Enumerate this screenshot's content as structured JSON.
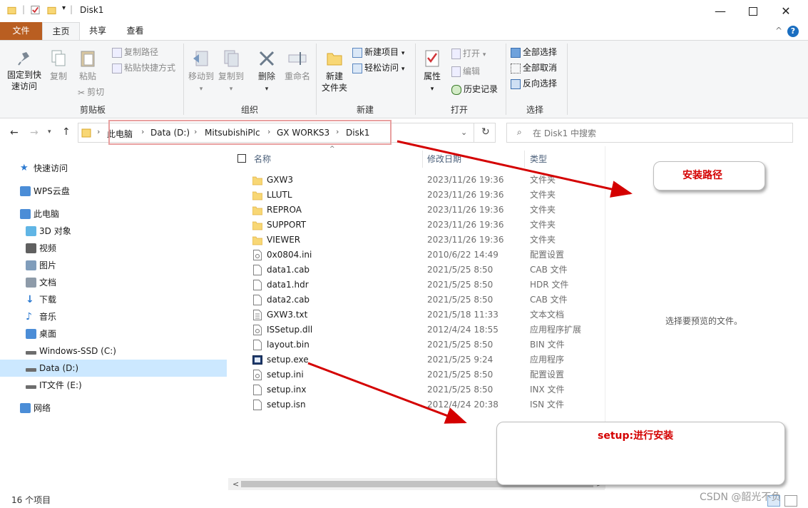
{
  "window": {
    "title": "Disk1"
  },
  "tabs": {
    "file": "文件",
    "home": "主页",
    "share": "共享",
    "view": "查看"
  },
  "ribbon": {
    "clipboard": {
      "pin": [
        "固定到快",
        "速访问"
      ],
      "copy": "复制",
      "paste": "粘贴",
      "copy_path": "复制路径",
      "paste_shortcut": "粘贴快捷方式",
      "cut": "剪切",
      "label": "剪贴板"
    },
    "organize": {
      "move_to": "移动到",
      "copy_to": "复制到",
      "delete": "删除",
      "rename": "重命名",
      "label": "组织"
    },
    "new": {
      "new_item": "新建项目",
      "easy_access": "轻松访问",
      "new_folder": [
        "新建",
        "文件夹"
      ],
      "label": "新建"
    },
    "open": {
      "properties": "属性",
      "open": "打开",
      "edit": "编辑",
      "history": "历史记录",
      "label": "打开"
    },
    "select": {
      "select_all": "全部选择",
      "select_none": "全部取消",
      "invert": "反向选择",
      "label": "选择"
    }
  },
  "address": {
    "crumbs": [
      "此电脑",
      "Data (D:)",
      "MitsubishiPlc",
      "GX WORKS3",
      "Disk1"
    ]
  },
  "search": {
    "placeholder": "在 Disk1 中搜索"
  },
  "nav": [
    {
      "label": "快速访问",
      "icon": "star-icon"
    },
    {
      "label": "WPS云盘",
      "icon": "cloud-icon"
    },
    {
      "label": "此电脑",
      "icon": "pc-icon"
    },
    {
      "label": "3D 对象",
      "icon": "cube-icon"
    },
    {
      "label": "视频",
      "icon": "video-icon"
    },
    {
      "label": "图片",
      "icon": "picture-icon"
    },
    {
      "label": "文档",
      "icon": "document-icon"
    },
    {
      "label": "下载",
      "icon": "download-icon"
    },
    {
      "label": "音乐",
      "icon": "music-icon"
    },
    {
      "label": "桌面",
      "icon": "desktop-icon"
    },
    {
      "label": "Windows-SSD (C:)",
      "icon": "drive-icon"
    },
    {
      "label": "Data (D:)",
      "icon": "drive-icon",
      "selected": true
    },
    {
      "label": "IT文件 (E:)",
      "icon": "drive-icon"
    },
    {
      "label": "网络",
      "icon": "network-icon"
    }
  ],
  "columns": {
    "name": "名称",
    "date": "修改日期",
    "type": "类型"
  },
  "files": [
    {
      "name": "GXW3",
      "date": "2023/11/26 19:36",
      "type": "文件夹",
      "icon": "folder"
    },
    {
      "name": "LLUTL",
      "date": "2023/11/26 19:36",
      "type": "文件夹",
      "icon": "folder"
    },
    {
      "name": "REPROA",
      "date": "2023/11/26 19:36",
      "type": "文件夹",
      "icon": "folder"
    },
    {
      "name": "SUPPORT",
      "date": "2023/11/26 19:36",
      "type": "文件夹",
      "icon": "folder"
    },
    {
      "name": "VIEWER",
      "date": "2023/11/26 19:36",
      "type": "文件夹",
      "icon": "folder"
    },
    {
      "name": "0x0804.ini",
      "date": "2010/6/22 14:49",
      "type": "配置设置",
      "icon": "ini"
    },
    {
      "name": "data1.cab",
      "date": "2021/5/25 8:50",
      "type": "CAB 文件",
      "icon": "file"
    },
    {
      "name": "data1.hdr",
      "date": "2021/5/25 8:50",
      "type": "HDR 文件",
      "icon": "file"
    },
    {
      "name": "data2.cab",
      "date": "2021/5/25 8:50",
      "type": "CAB 文件",
      "icon": "file"
    },
    {
      "name": "GXW3.txt",
      "date": "2021/5/18 11:33",
      "type": "文本文档",
      "icon": "txt"
    },
    {
      "name": "ISSetup.dll",
      "date": "2012/4/24 18:55",
      "type": "应用程序扩展",
      "icon": "dll"
    },
    {
      "name": "layout.bin",
      "date": "2021/5/25 8:50",
      "type": "BIN 文件",
      "icon": "file"
    },
    {
      "name": "setup.exe",
      "date": "2021/5/25 9:24",
      "type": "应用程序",
      "icon": "exe"
    },
    {
      "name": "setup.ini",
      "date": "2021/5/25 8:50",
      "type": "配置设置",
      "icon": "ini"
    },
    {
      "name": "setup.inx",
      "date": "2021/5/25 8:50",
      "type": "INX 文件",
      "icon": "file"
    },
    {
      "name": "setup.isn",
      "date": "2012/4/24 20:38",
      "type": "ISN 文件",
      "icon": "file"
    }
  ],
  "preview": {
    "text": "选择要预览的文件。"
  },
  "status": {
    "count": "16 个项目"
  },
  "annotations": {
    "install_path": "安装路径",
    "setup_note": "setup:进行安装"
  },
  "watermark": "CSDN @韶光不负",
  "colors": {
    "file_tab": "#b95e21",
    "highlight": "#e8a0a0",
    "arrow": "#d40000",
    "selected_nav": "#cce8ff"
  }
}
